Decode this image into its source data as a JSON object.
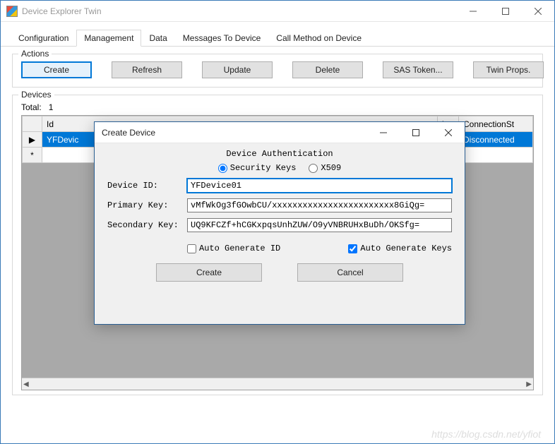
{
  "window": {
    "title": "Device Explorer Twin"
  },
  "tabs": [
    {
      "label": "Configuration"
    },
    {
      "label": "Management"
    },
    {
      "label": "Data"
    },
    {
      "label": "Messages To Device"
    },
    {
      "label": "Call Method on Device"
    }
  ],
  "activeTab": 1,
  "actions": {
    "legend": "Actions",
    "buttons": {
      "create": "Create",
      "refresh": "Refresh",
      "update": "Update",
      "delete": "Delete",
      "sas": "SAS Token...",
      "twin": "Twin Props."
    }
  },
  "devices": {
    "legend": "Devices",
    "totalLabel": "Total:",
    "totalValue": "1",
    "columns": {
      "id": "Id",
      "pri": "ir",
      "conn": "ConnectionSt"
    },
    "rows": [
      {
        "marker": "▶",
        "id": "YFDevic",
        "pri": "..",
        "conn": "Disconnected"
      }
    ],
    "newRowMarker": "*"
  },
  "dialog": {
    "title": "Create Device",
    "authLabel": "Device Authentication",
    "radios": {
      "security": "Security Keys",
      "x509": "X509"
    },
    "fields": {
      "deviceIdLabel": "Device ID:",
      "deviceIdValue": "YFDevice01",
      "primaryLabel": "Primary Key:",
      "primaryValue": "vMfWkOg3fGOwbCU/xxxxxxxxxxxxxxxxxxxxxxxx8GiQg=",
      "secondaryLabel": "Secondary Key:",
      "secondaryValue": "UQ9KFCZf+hCGKxpqsUnhZUW/O9yVNBRUHxBuDh/OKSfg="
    },
    "checks": {
      "autoId": "Auto Generate ID",
      "autoKeys": "Auto Generate Keys"
    },
    "buttons": {
      "create": "Create",
      "cancel": "Cancel"
    }
  },
  "watermark": "https://blog.csdn.net/yfiot"
}
